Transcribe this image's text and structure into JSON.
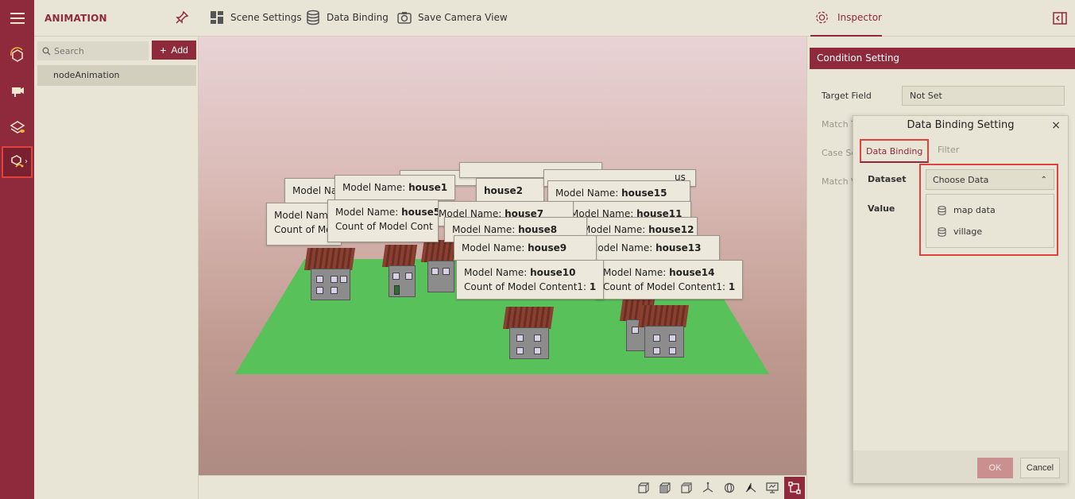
{
  "app": {
    "title": "ANIMATION"
  },
  "rail": {
    "menu_icon": "hamburger-icon",
    "items": [
      {
        "icon": "animation-cube-icon"
      },
      {
        "icon": "camera-scene-icon"
      },
      {
        "icon": "layers-data-icon"
      },
      {
        "icon": "node-animation-icon",
        "selected": true
      }
    ]
  },
  "toolbar": {
    "scene_settings": "Scene Settings",
    "data_binding": "Data Binding",
    "save_camera_view": "Save Camera View",
    "inspector": "Inspector"
  },
  "side": {
    "search_placeholder": "Search",
    "add_label": "Add",
    "items": [
      "nodeAnimation"
    ]
  },
  "labels": [
    {
      "text": "Model Na",
      "bold": ""
    },
    {
      "text": "Model Name: ",
      "bold": "house1"
    },
    {
      "text": "",
      "bold": "house2"
    },
    {
      "text": "us",
      "bold": ""
    },
    {
      "text": "Model Name: ",
      "bold": "house15"
    },
    {
      "text": "Model Name",
      "bold": "",
      "line2": "Count of Mo"
    },
    {
      "text": "Model Name: ",
      "bold": "house5",
      "line2": "Count of Model Cont"
    },
    {
      "text": "Model Name: ",
      "bold": "house7"
    },
    {
      "text": "Model Name: ",
      "bold": "house11"
    },
    {
      "text": "Model Name: ",
      "bold": "house8"
    },
    {
      "text": "Model Name: ",
      "bold": "house12"
    },
    {
      "text": "Model Name: ",
      "bold": "house9"
    },
    {
      "text": "Model Name: ",
      "bold": "house13"
    },
    {
      "text": "Model Name: ",
      "bold": "house10",
      "line2": "Count of Model Content1: ",
      "line2_bold": "1"
    },
    {
      "text": "Model Name: ",
      "bold": "house14",
      "line2": "Count of Model Content1: ",
      "line2_bold": "1"
    }
  ],
  "inspector": {
    "section": "Condition Setting",
    "target_field_label": "Target Field",
    "target_field_value": "Not Set",
    "match_type_label": "Match T",
    "case_sensitive_label": "Case Se",
    "match_value_label": "Match V"
  },
  "dialog": {
    "title": "Data Binding Setting",
    "close": "×",
    "tabs": [
      "Data Binding",
      "Filter"
    ],
    "dataset_label": "Dataset",
    "value_label": "Value",
    "select_placeholder": "Choose Data",
    "caret": "⌃",
    "options": [
      "map data",
      "village"
    ],
    "ok": "OK",
    "cancel": "Cancel"
  },
  "colors": {
    "brand": "#8e2a3b",
    "highlight": "#e0433d",
    "ground": "#58c159"
  }
}
